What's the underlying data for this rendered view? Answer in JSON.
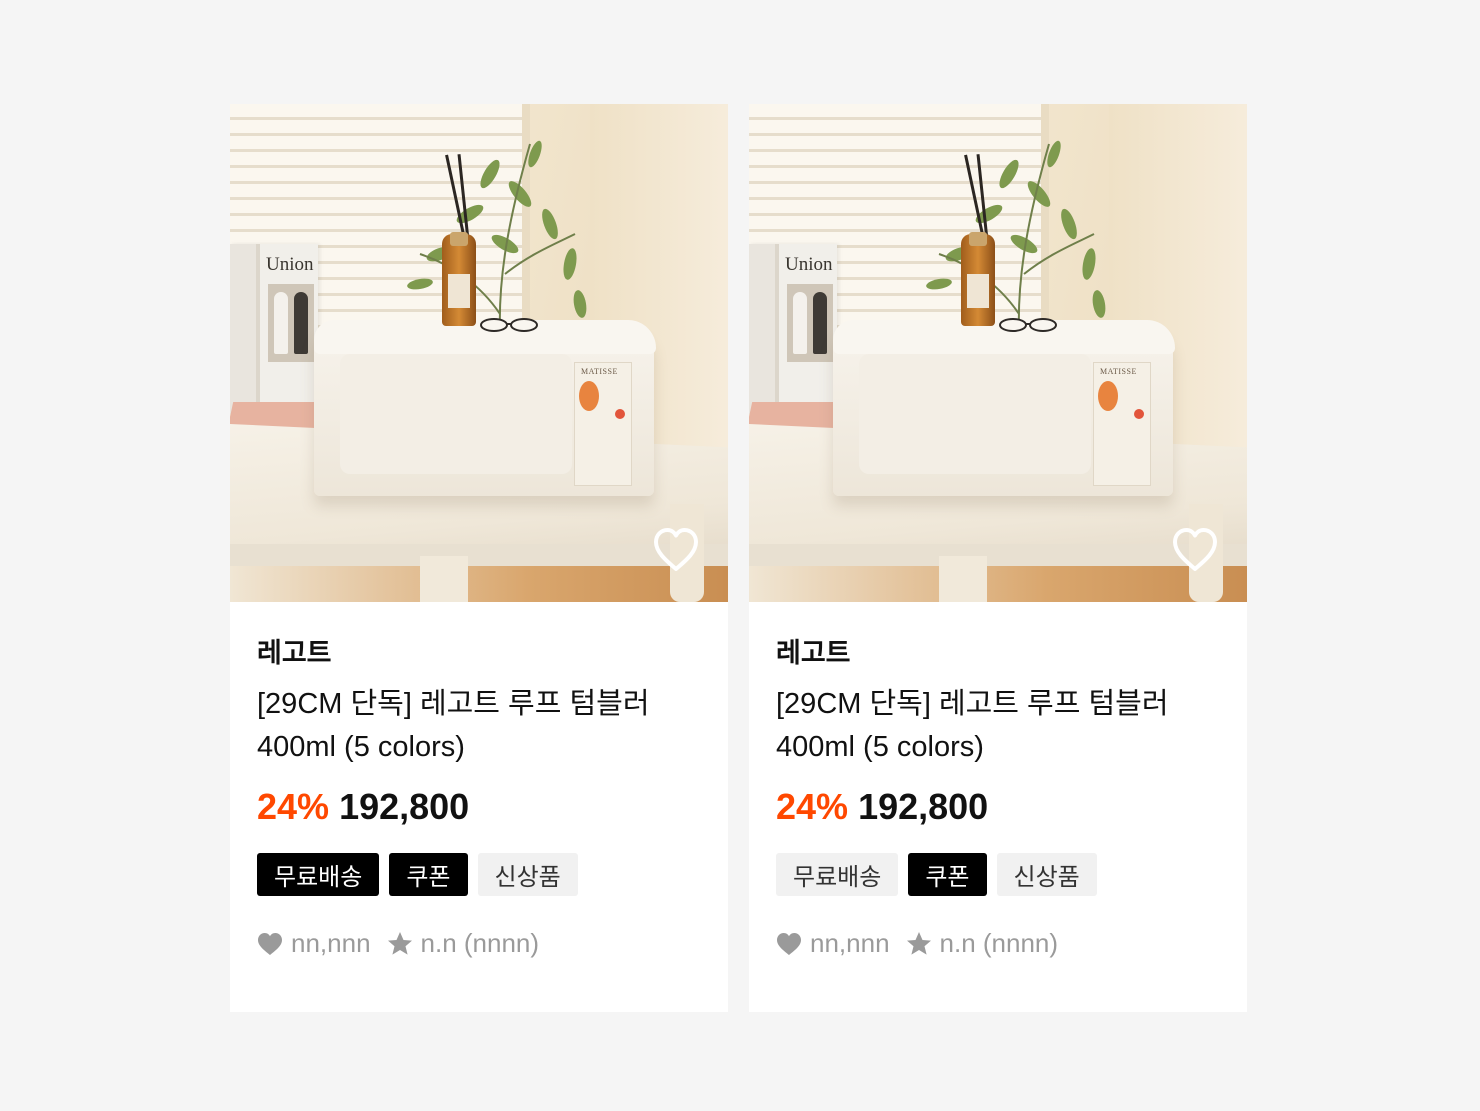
{
  "products": [
    {
      "brand": "레고트",
      "title": "[29CM 단독] 레고트 루프 텀블러 400ml (5 colors)",
      "discount": "24%",
      "price": "192,800",
      "badges": [
        {
          "label": "무료배송",
          "style": "dark"
        },
        {
          "label": "쿠폰",
          "style": "dark"
        },
        {
          "label": "신상품",
          "style": "light"
        }
      ],
      "likes": "nn,nnn",
      "rating": "n.n (nnnn)",
      "image": {
        "book_title": "Union",
        "poster_text": "MATISSE"
      }
    },
    {
      "brand": "레고트",
      "title": "[29CM 단독] 레고트 루프 텀블러 400ml (5 colors)",
      "discount": "24%",
      "price": "192,800",
      "badges": [
        {
          "label": "무료배송",
          "style": "light"
        },
        {
          "label": "쿠폰",
          "style": "dark"
        },
        {
          "label": "신상품",
          "style": "light"
        }
      ],
      "likes": "nn,nnn",
      "rating": "n.n (nnnn)",
      "image": {
        "book_title": "Union",
        "poster_text": "MATISSE"
      }
    }
  ],
  "colors": {
    "accent_discount": "#ff4800",
    "badge_dark": "#000000",
    "badge_light": "#f1f1f1",
    "meta_gray": "#9a9a9a"
  },
  "icons": {
    "wishlist": "heart-outline-icon",
    "likes": "heart-filled-icon",
    "rating": "star-icon"
  }
}
